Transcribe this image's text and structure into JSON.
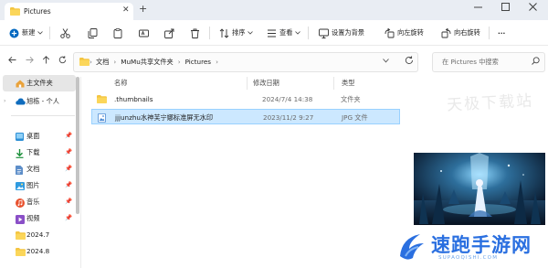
{
  "window": {
    "tab_title": "Pictures",
    "new_tab_symbol": "+",
    "tab_close_symbol": "✕"
  },
  "toolbar": {
    "new_label": "新建",
    "sort_label": "排序",
    "view_label": "查看",
    "set_background_label": "设置为背景",
    "rotate_left_label": "向左旋转",
    "rotate_right_label": "向右旋转",
    "more_label": "···"
  },
  "address": {
    "crumbs": [
      "文档",
      "MuMu共享文件夹",
      "Pictures"
    ],
    "search_placeholder": "在 Pictures 中搜索"
  },
  "sidebar": {
    "home_label": "主文件夹",
    "cloud_label": "旭栋 - 个人",
    "items": [
      {
        "label": "桌面",
        "icon": "desktop-icon"
      },
      {
        "label": "下载",
        "icon": "download-icon"
      },
      {
        "label": "文档",
        "icon": "document-icon"
      },
      {
        "label": "图片",
        "icon": "picture-icon"
      },
      {
        "label": "音乐",
        "icon": "music-icon"
      },
      {
        "label": "视频",
        "icon": "video-icon"
      },
      {
        "label": "2024.7",
        "icon": "folder-icon"
      },
      {
        "label": "2024.8",
        "icon": "folder-icon"
      }
    ]
  },
  "filelist": {
    "columns": {
      "name": "名称",
      "date": "修改日期",
      "type": "类型"
    },
    "rows": [
      {
        "name": ".thumbnails",
        "date": "2024/7/4 14:38",
        "type": "文件夹",
        "icon": "folder-icon"
      },
      {
        "name": "jjjunzhu水神芙宁娜标准屏无水印",
        "date": "2023/11/2 9:27",
        "type": "JPG 文件",
        "icon": "image-file-icon",
        "selected": true
      }
    ]
  },
  "watermark": {
    "top_text": "天极下载站",
    "brand_name": "速跑手游网",
    "brand_site": "SUPAOQISHI.COM"
  },
  "colors": {
    "accent": "#0067c0",
    "selection_bg": "#cce8ff",
    "folder": "#f4c542",
    "brand": "#2a6fe0"
  }
}
